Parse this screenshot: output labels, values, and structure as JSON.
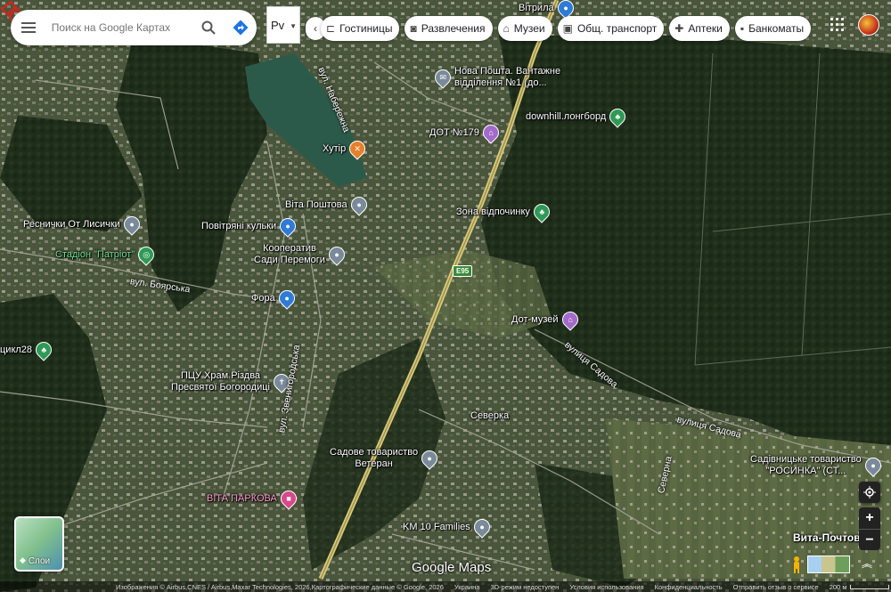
{
  "search": {
    "placeholder": "Поиск на Google Картах"
  },
  "language_select": {
    "value": "Рv"
  },
  "chips": [
    {
      "icon": "hotel-icon",
      "glyph": "🛏",
      "label": "Гостиницы"
    },
    {
      "icon": "camera-icon",
      "glyph": "◙",
      "label": "Развлечения"
    },
    {
      "icon": "museum-icon",
      "glyph": "⌂",
      "label": "Музеи"
    },
    {
      "icon": "bus-icon",
      "glyph": "▣",
      "label": "Общ. транспорт"
    },
    {
      "icon": "pharmacy-icon",
      "glyph": "✚",
      "label": "Аптеки"
    },
    {
      "icon": "atm-icon",
      "glyph": "▪",
      "label": "Банкоматы"
    }
  ],
  "places": [
    {
      "label": "Нова Пошта. Вантажне",
      "label2": "відділення №1 (до...",
      "icon": "mail-icon",
      "color": "#7a8a9a",
      "glyph": "✉"
    },
    {
      "label": "downhill.лонгборд",
      "icon": "park-icon",
      "color": "#2e9a55",
      "glyph": "♣"
    },
    {
      "label": "ДОТ №179",
      "icon": "museum-icon",
      "color": "#a36ac9",
      "glyph": "⌂"
    },
    {
      "label": "Хутір",
      "icon": "restaurant-icon",
      "color": "#e6802b",
      "glyph": "🍴"
    },
    {
      "label": "Віта Поштова",
      "icon": "location-icon",
      "color": "#7a8a9a",
      "glyph": "●"
    },
    {
      "label": "Зона відпочинку",
      "icon": "park-icon",
      "color": "#2e9a55",
      "glyph": "♣"
    },
    {
      "label": "Реснички От Лисички",
      "icon": "location-icon",
      "color": "#7a8a9a",
      "glyph": "●"
    },
    {
      "label": "Повітряні кульки",
      "icon": "shopping-icon",
      "color": "#2f7bd6",
      "glyph": "🛍"
    },
    {
      "label": "Стадіон \"Патріот\"",
      "icon": "stadium-icon",
      "color": "#2e9a55",
      "glyph": "◎"
    },
    {
      "label": "Кооператив",
      "label2": "Сади Перемоги",
      "icon": "location-icon",
      "color": "#7a8a9a",
      "glyph": "●"
    },
    {
      "label": "Фора",
      "icon": "shopping-icon",
      "color": "#2f7bd6",
      "glyph": "🛒"
    },
    {
      "label": "Дот-музей",
      "icon": "museum-icon",
      "color": "#a36ac9",
      "glyph": "⌂"
    },
    {
      "label": "цикл28",
      "icon": "park-icon",
      "color": "#2e9a55",
      "glyph": "♣"
    },
    {
      "label": "ПЦУ Храм Різдва",
      "label2": "Пресвятої Богородиці",
      "icon": "church-icon",
      "color": "#7a8a9a",
      "glyph": "✝"
    },
    {
      "label": "Северка",
      "icon": "none",
      "color": "",
      "glyph": ""
    },
    {
      "label": "Садове товариство",
      "label2": "Ветеран",
      "icon": "location-icon",
      "color": "#7a8a9a",
      "glyph": "●"
    },
    {
      "label": "ВІТА ПАРКОВА",
      "icon": "hotel-icon",
      "color": "#d9488b",
      "glyph": "🛏"
    },
    {
      "label": "KM 10 Families",
      "icon": "location-icon",
      "color": "#7a8a9a",
      "glyph": "●"
    },
    {
      "label": "Садівницьке товариство",
      "label2": "\"РОСИНКА\" (СТ...",
      "icon": "location-icon",
      "color": "#7a8a9a",
      "glyph": "●"
    },
    {
      "label": "Вита-Почтовая",
      "icon": "none",
      "color": "",
      "glyph": ""
    },
    {
      "label": "Вітрила",
      "icon": "location-icon",
      "color": "#2f7bd6",
      "glyph": "●"
    }
  ],
  "streets": [
    {
      "label": "вул. Набережна"
    },
    {
      "label": "вул. Боярська"
    },
    {
      "label": "вул. Звенигородська"
    },
    {
      "label": "вулиця Садова"
    },
    {
      "label": "вулиця Садова"
    },
    {
      "label": "Северна"
    }
  ],
  "route_shield": "E95",
  "layers": {
    "label": "Слои"
  },
  "logo": "Google Maps",
  "attribution": {
    "imagery": "Изображения © Airbus,CNES / Airbus,Maxar Technologies, 2026,Картографические данные © Google, 2026",
    "country": "Украина",
    "mode_3d": "3D-режим недоступен",
    "terms": "Условия использования",
    "privacy": "Конфиденциальность",
    "feedback": "Отправить отзыв о сервисе",
    "scale": "200 м"
  }
}
